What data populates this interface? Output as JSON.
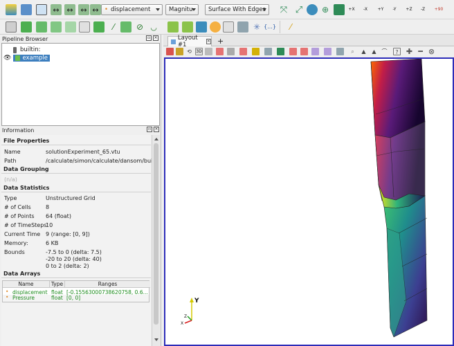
{
  "toolbar": {
    "array_select": "displacement",
    "component_select": "Magnitu",
    "representation_select": "Surface With Edges",
    "view_labels": {
      "plus_x": "+X",
      "minus_x": "-X",
      "plus_y": "+Y",
      "minus_y": "-Y",
      "plus_z": "+Z",
      "minus_z": "-Z",
      "rotate_90": "+90"
    },
    "filter_label": "{...}",
    "view_3d": "3D"
  },
  "pipeline": {
    "title": "Pipeline Browser",
    "items": [
      {
        "label": "builtin:"
      },
      {
        "label": "example"
      }
    ]
  },
  "information": {
    "title": "Information",
    "file_properties": {
      "heading": "File Properties",
      "name_key": "Name",
      "name_val": "solutionExperiment_65.vtu",
      "path_key": "Path",
      "path_val": "/calculate/simon/calculate/dansom/build"
    },
    "data_grouping": {
      "heading": "Data Grouping",
      "value": "(n/a)"
    },
    "data_statistics": {
      "heading": "Data Statistics",
      "type_key": "Type",
      "type_val": "Unstructured Grid",
      "cells_key": "# of Cells",
      "cells_val": "8",
      "points_key": "# of Points",
      "points_val": "64 (float)",
      "timesteps_key": "# of TimeSteps",
      "timesteps_val": "10",
      "time_key": "Current Time",
      "time_val": "9 (range: [0, 9])",
      "memory_key": "Memory:",
      "memory_val": "6 KB",
      "bounds_key": "Bounds",
      "bounds_1": "-7.5 to 0 (delta: 7.5)",
      "bounds_2": "-20 to 20 (delta: 40)",
      "bounds_3": "0 to 2 (delta: 2)"
    },
    "data_arrays": {
      "heading": "Data Arrays",
      "columns": [
        "Name",
        "Type",
        "Ranges"
      ],
      "rows": [
        {
          "name": "displacement",
          "type": "float",
          "ranges": "[-0.15563000738620758, 0.6..."
        },
        {
          "name": "Pressure",
          "type": "float",
          "ranges": "[0, 0]"
        }
      ]
    }
  },
  "layout": {
    "tab_label": "Layout #1",
    "add_tab": "+"
  },
  "axes": {
    "y": "Y",
    "z": "Z",
    "x": "X"
  },
  "colors": {
    "accent": "#3d7fbf",
    "viewport_border": "#2b2bb8",
    "array_text": "#1c8a1c"
  }
}
